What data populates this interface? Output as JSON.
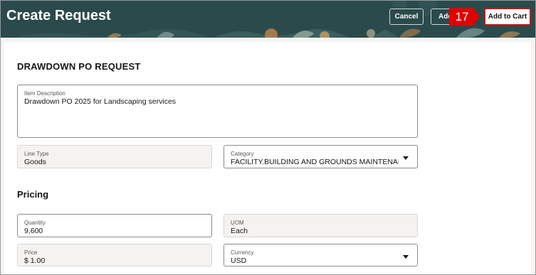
{
  "header": {
    "title": "Create Request",
    "cancel_label": "Cancel",
    "add_requisition_label": "Add",
    "add_to_cart_label": "Add to Cart",
    "step_number": "17",
    "colors": {
      "header_bg": "#2b4a4c",
      "badge": "#e00000"
    }
  },
  "form": {
    "section_title": "DRAWDOWN PO REQUEST",
    "item_description": {
      "label": "Item Description",
      "value": "Drawdown PO 2025 for Landscaping services"
    },
    "line_type": {
      "label": "Line Type",
      "value": "Goods"
    },
    "category": {
      "label": "Category",
      "value": "FACILITY.BUILDING AND GROUNDS MAINTENANCE"
    },
    "pricing_title": "Pricing",
    "quantity": {
      "label": "Quantity",
      "value": "9,600"
    },
    "uom": {
      "label": "UOM",
      "value": "Each"
    },
    "price": {
      "label": "Price",
      "value": "$ 1.00"
    },
    "currency": {
      "label": "Currency",
      "value": "USD"
    }
  }
}
